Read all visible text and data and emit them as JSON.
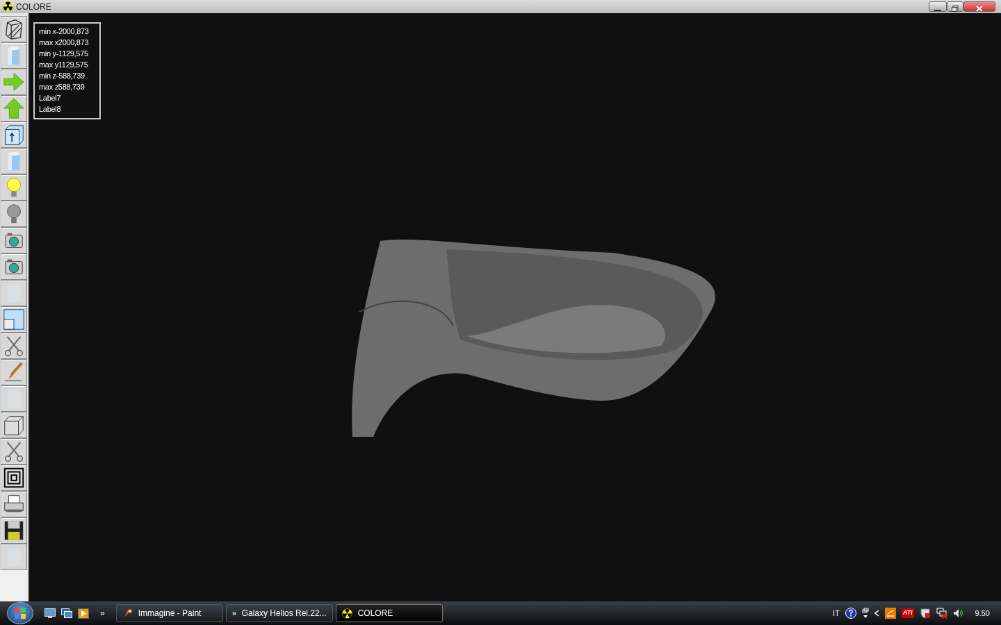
{
  "window": {
    "title": "COLORE"
  },
  "toolbar": [
    {
      "kind": "wireframe",
      "disabled": false
    },
    {
      "kind": "cylinder",
      "disabled": false
    },
    {
      "kind": "arrow-right",
      "disabled": false
    },
    {
      "kind": "arrow-up",
      "disabled": false
    },
    {
      "kind": "box-up",
      "disabled": false
    },
    {
      "kind": "cylinder",
      "disabled": false
    },
    {
      "kind": "bulb-on",
      "disabled": false
    },
    {
      "kind": "bulb-off",
      "disabled": false
    },
    {
      "kind": "camera",
      "disabled": false
    },
    {
      "kind": "camera",
      "disabled": false
    },
    {
      "kind": "blank",
      "disabled": true
    },
    {
      "kind": "window",
      "disabled": false
    },
    {
      "kind": "scissors",
      "disabled": false
    },
    {
      "kind": "brush",
      "disabled": false
    },
    {
      "kind": "blank",
      "disabled": true
    },
    {
      "kind": "cube",
      "disabled": false
    },
    {
      "kind": "scissors",
      "disabled": false
    },
    {
      "kind": "squares",
      "disabled": false
    },
    {
      "kind": "printer",
      "disabled": false
    },
    {
      "kind": "floppy",
      "disabled": false
    },
    {
      "kind": "blank",
      "disabled": true
    }
  ],
  "info_labels": [
    "min x-2000,873",
    "max x2000,873",
    "min y-1129,575",
    "max y1129,575",
    "min z-588,739",
    "max z588,739",
    "Label7",
    "Label8"
  ],
  "taskbar": {
    "overflow": "»",
    "tasks": [
      {
        "label": "Immagine - Paint",
        "kind": "paint",
        "selected": false
      },
      {
        "label": "Galaxy Helios  Rel.22...",
        "kind": "app",
        "selected": false
      },
      {
        "label": "COLORE",
        "kind": "radiation",
        "selected": true
      }
    ],
    "language": "IT",
    "ati": "ATI",
    "clock": "9.50"
  }
}
